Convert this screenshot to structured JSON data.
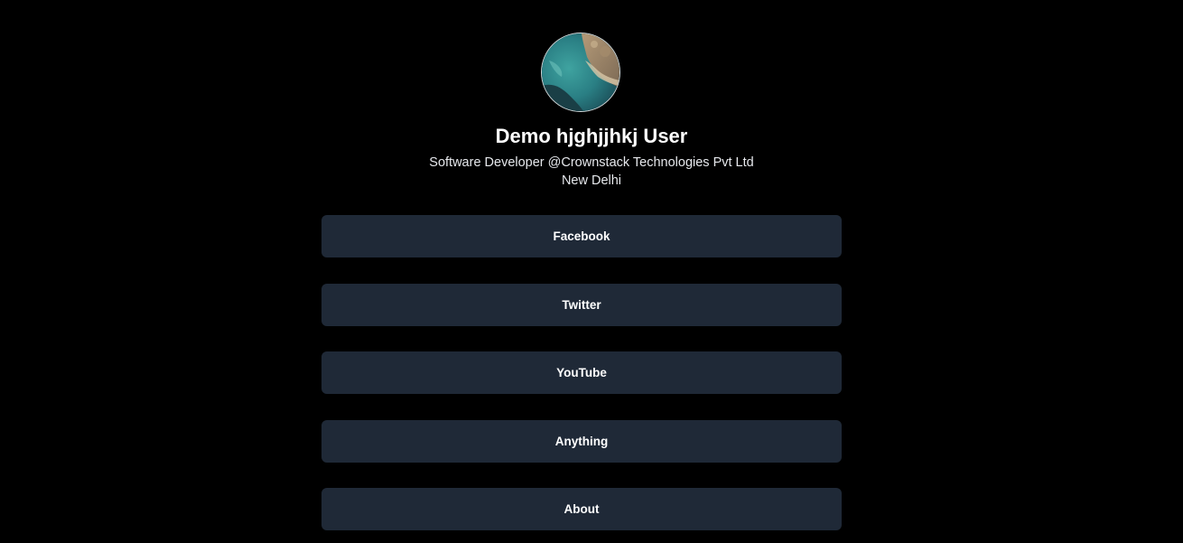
{
  "profile": {
    "name": "Demo hjghjjhkj User",
    "bio": "Software Developer @Crownstack Technologies Pvt Ltd",
    "location": "New Delhi"
  },
  "links": [
    {
      "label": "Facebook"
    },
    {
      "label": "Twitter"
    },
    {
      "label": "YouTube"
    },
    {
      "label": "Anything"
    },
    {
      "label": "About"
    }
  ],
  "colors": {
    "background": "#000000",
    "button": "#1f2937",
    "text": "#ffffff"
  }
}
